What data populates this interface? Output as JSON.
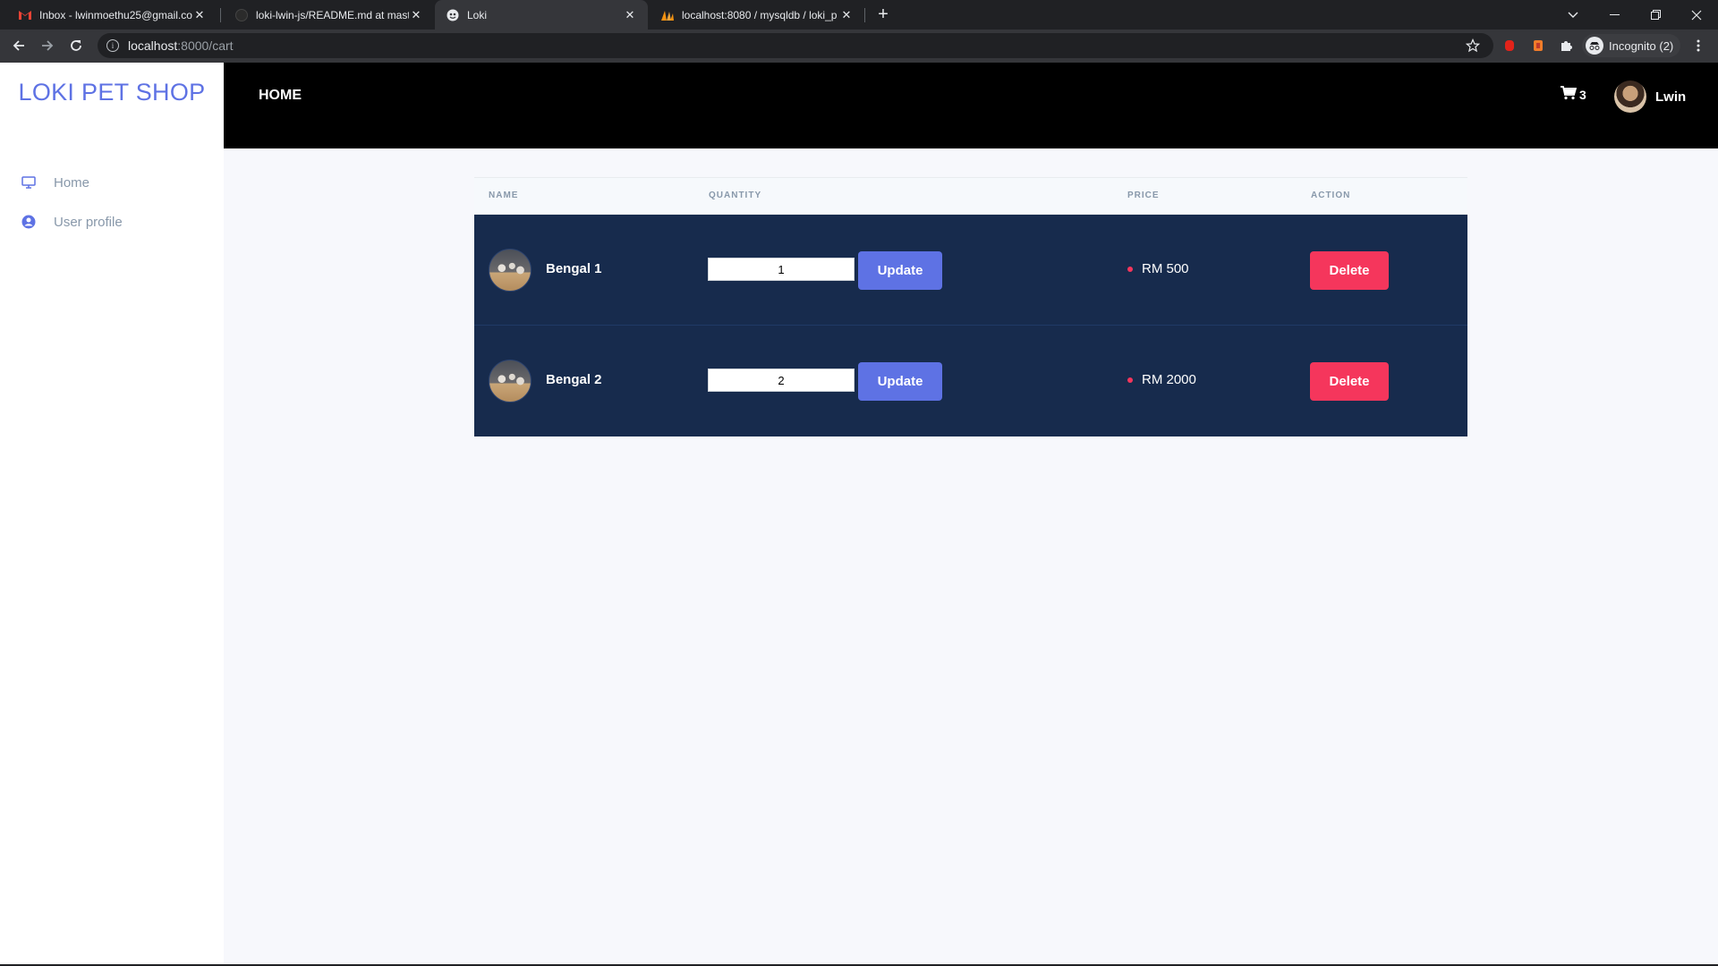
{
  "browser": {
    "tabs": [
      {
        "title": "Inbox - lwinmoethu25@gmail.co",
        "favicon": "gmail-icon",
        "active": false
      },
      {
        "title": "loki-lwin-js/README.md at maste",
        "favicon": "github-icon",
        "active": false
      },
      {
        "title": "Loki",
        "favicon": "loki-icon",
        "active": true
      },
      {
        "title": "localhost:8080 / mysqldb / loki_p",
        "favicon": "phpmyadmin-icon",
        "active": false
      }
    ],
    "address": {
      "host": "localhost",
      "path": ":8000/cart"
    },
    "profile_label": "Incognito (2)"
  },
  "app": {
    "brand": "LOKI PET SHOP",
    "sidebar": {
      "items": [
        {
          "label": "Home",
          "icon": "monitor-icon"
        },
        {
          "label": "User profile",
          "icon": "user-circle-icon"
        }
      ]
    },
    "topnav": {
      "home_label": "HOME",
      "cart_count": "3",
      "user_name": "Lwin"
    },
    "cart_table": {
      "columns": [
        "NAME",
        "QUANTITY",
        "PRICE",
        "ACTION"
      ],
      "rows": [
        {
          "name": "Bengal 1",
          "quantity": "1",
          "update_label": "Update",
          "price": "RM 500",
          "delete_label": "Delete"
        },
        {
          "name": "Bengal 2",
          "quantity": "2",
          "update_label": "Update",
          "price": "RM 2000",
          "delete_label": "Delete"
        }
      ]
    },
    "colors": {
      "brand": "#5e72e4",
      "table_body": "#172b4d",
      "danger": "#f5365c",
      "primary_button": "#5e72e4"
    }
  }
}
